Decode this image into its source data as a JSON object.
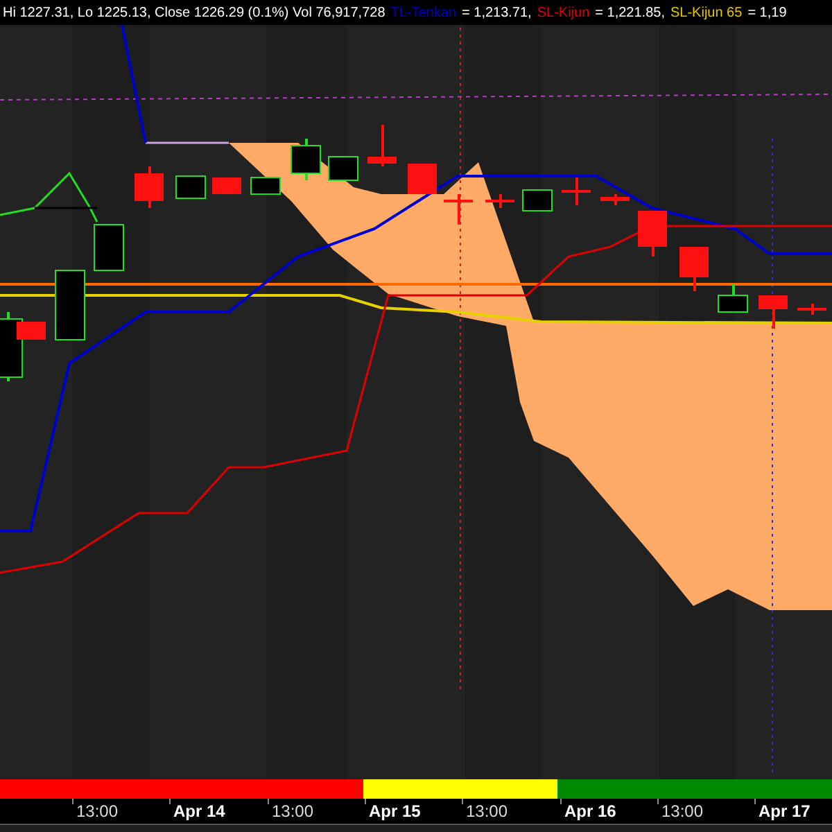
{
  "header": {
    "stats": "Hi 1227.31, Lo 1225.13, Close 1226.29 (0.1%) Vol 76,917,728",
    "legend": [
      {
        "name": "TL-Tenkan",
        "color": "#0000cc",
        "value": "= 1,213.71,"
      },
      {
        "name": "SL-Kijun",
        "color": "#e00000",
        "value": "= 1,221.85,"
      },
      {
        "name": "SL-Kijun 65",
        "color": "#e6c700",
        "value": "= 1,19"
      }
    ]
  },
  "signal_band": [
    {
      "color": "#ff0000"
    },
    {
      "color": "#ffff00"
    },
    {
      "color": "#008800"
    }
  ],
  "time_axis": [
    "13:00",
    "Apr 14",
    "13:00",
    "Apr 15",
    "13:00",
    "Apr 16",
    "13:00",
    "Apr 17"
  ]
}
